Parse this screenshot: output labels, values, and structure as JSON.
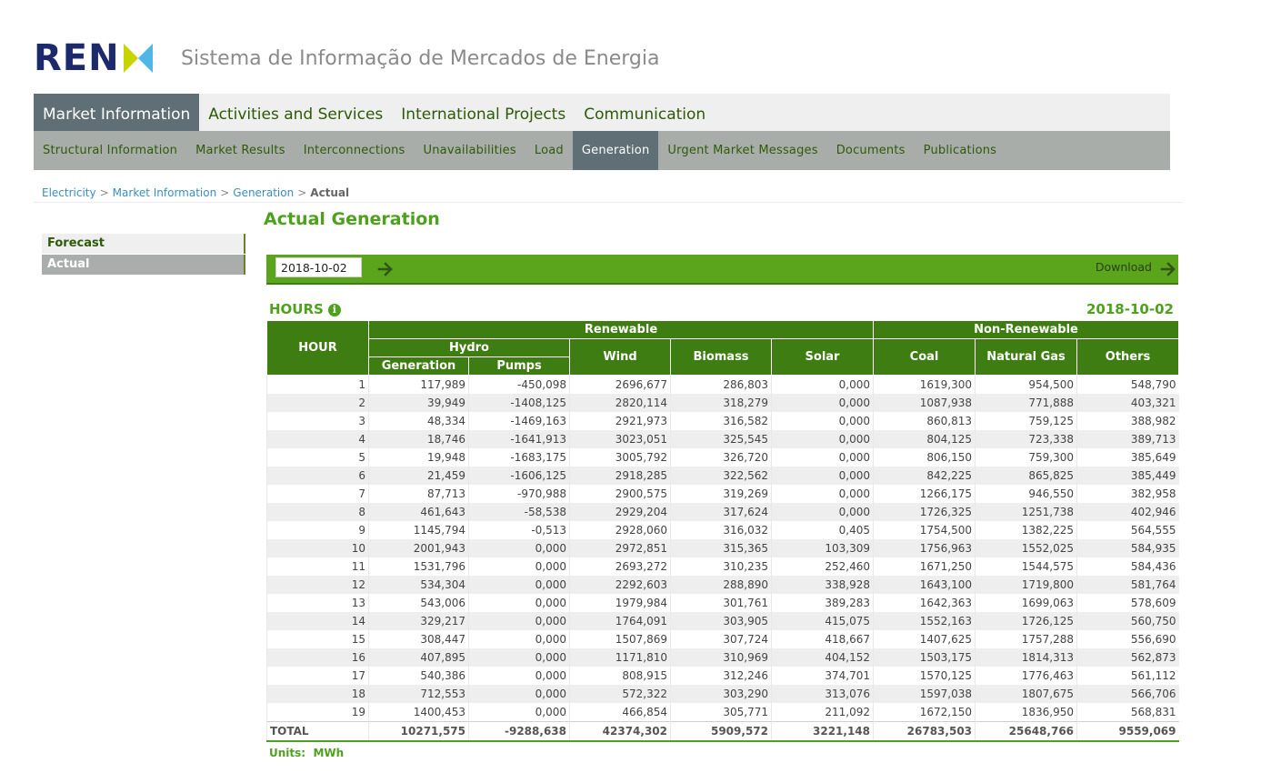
{
  "header": {
    "logo_text": "REN",
    "site_title": "Sistema de Informação de Mercados de Energia",
    "logo_colors": {
      "text": "#1c2a6b",
      "mark_left": "#c6d400",
      "mark_right": "#4fb7e6"
    }
  },
  "nav_primary": [
    {
      "label": "Market Information",
      "active": true
    },
    {
      "label": "Activities and Services",
      "active": false
    },
    {
      "label": "International Projects",
      "active": false
    },
    {
      "label": "Communication",
      "active": false
    }
  ],
  "nav_secondary": [
    {
      "label": "Structural Information",
      "active": false
    },
    {
      "label": "Market Results",
      "active": false
    },
    {
      "label": "Interconnections",
      "active": false
    },
    {
      "label": "Unavailabilities",
      "active": false
    },
    {
      "label": "Load",
      "active": false
    },
    {
      "label": "Generation",
      "active": true
    },
    {
      "label": "Urgent Market Messages",
      "active": false
    },
    {
      "label": "Documents",
      "active": false
    },
    {
      "label": "Publications",
      "active": false
    }
  ],
  "breadcrumb": {
    "items": [
      "Electricity",
      "Market Information",
      "Generation"
    ],
    "current": "Actual",
    "separator": ">"
  },
  "sidebar": {
    "forecast": "Forecast",
    "actual": "Actual"
  },
  "page_title": "Actual Generation",
  "toolbar": {
    "date_value": "2018-10-02",
    "download_label": "Download"
  },
  "section": {
    "hours_label": "HOURS",
    "date": "2018-10-02",
    "units_label": "Units:",
    "units_value": "MWh"
  },
  "table": {
    "headers": {
      "hour": "HOUR",
      "renewable": "Renewable",
      "non_renewable": "Non-Renewable",
      "hydro": "Hydro",
      "generation": "Generation",
      "pumps": "Pumps",
      "wind": "Wind",
      "biomass": "Biomass",
      "solar": "Solar",
      "coal": "Coal",
      "natural_gas": "Natural Gas",
      "others": "Others"
    },
    "rows": [
      [
        "1",
        "117,989",
        "-450,098",
        "2696,677",
        "286,803",
        "0,000",
        "1619,300",
        "954,500",
        "548,790"
      ],
      [
        "2",
        "39,949",
        "-1408,125",
        "2820,114",
        "318,279",
        "0,000",
        "1087,938",
        "771,888",
        "403,321"
      ],
      [
        "3",
        "48,334",
        "-1469,163",
        "2921,973",
        "316,582",
        "0,000",
        "860,813",
        "759,125",
        "388,982"
      ],
      [
        "4",
        "18,746",
        "-1641,913",
        "3023,051",
        "325,545",
        "0,000",
        "804,125",
        "723,338",
        "389,713"
      ],
      [
        "5",
        "19,948",
        "-1683,175",
        "3005,792",
        "326,720",
        "0,000",
        "806,150",
        "759,300",
        "385,649"
      ],
      [
        "6",
        "21,459",
        "-1606,125",
        "2918,285",
        "322,562",
        "0,000",
        "842,225",
        "865,825",
        "385,449"
      ],
      [
        "7",
        "87,713",
        "-970,988",
        "2900,575",
        "319,269",
        "0,000",
        "1266,175",
        "946,550",
        "382,958"
      ],
      [
        "8",
        "461,643",
        "-58,538",
        "2929,204",
        "317,624",
        "0,000",
        "1726,325",
        "1251,738",
        "402,946"
      ],
      [
        "9",
        "1145,794",
        "-0,513",
        "2928,060",
        "316,032",
        "0,405",
        "1754,500",
        "1382,225",
        "564,555"
      ],
      [
        "10",
        "2001,943",
        "0,000",
        "2972,851",
        "315,365",
        "103,309",
        "1756,963",
        "1552,025",
        "584,935"
      ],
      [
        "11",
        "1531,796",
        "0,000",
        "2693,272",
        "310,235",
        "252,460",
        "1671,250",
        "1544,575",
        "584,436"
      ],
      [
        "12",
        "534,304",
        "0,000",
        "2292,603",
        "288,890",
        "338,928",
        "1643,100",
        "1719,800",
        "581,764"
      ],
      [
        "13",
        "543,006",
        "0,000",
        "1979,984",
        "301,761",
        "389,283",
        "1642,363",
        "1699,063",
        "578,609"
      ],
      [
        "14",
        "329,217",
        "0,000",
        "1764,091",
        "303,905",
        "415,075",
        "1552,163",
        "1726,125",
        "560,750"
      ],
      [
        "15",
        "308,447",
        "0,000",
        "1507,869",
        "307,724",
        "418,667",
        "1407,625",
        "1757,288",
        "556,690"
      ],
      [
        "16",
        "407,895",
        "0,000",
        "1171,810",
        "310,969",
        "404,152",
        "1503,175",
        "1814,313",
        "562,873"
      ],
      [
        "17",
        "540,386",
        "0,000",
        "808,915",
        "312,246",
        "374,701",
        "1570,125",
        "1776,463",
        "561,112"
      ],
      [
        "18",
        "712,553",
        "0,000",
        "572,322",
        "303,290",
        "313,076",
        "1597,038",
        "1807,675",
        "566,706"
      ],
      [
        "19",
        "1400,453",
        "0,000",
        "466,854",
        "305,771",
        "211,092",
        "1672,150",
        "1836,950",
        "568,831"
      ]
    ],
    "total": [
      "TOTAL",
      "10271,575",
      "-9288,638",
      "42374,302",
      "5909,572",
      "3221,148",
      "26783,503",
      "25648,766",
      "9559,069"
    ]
  }
}
